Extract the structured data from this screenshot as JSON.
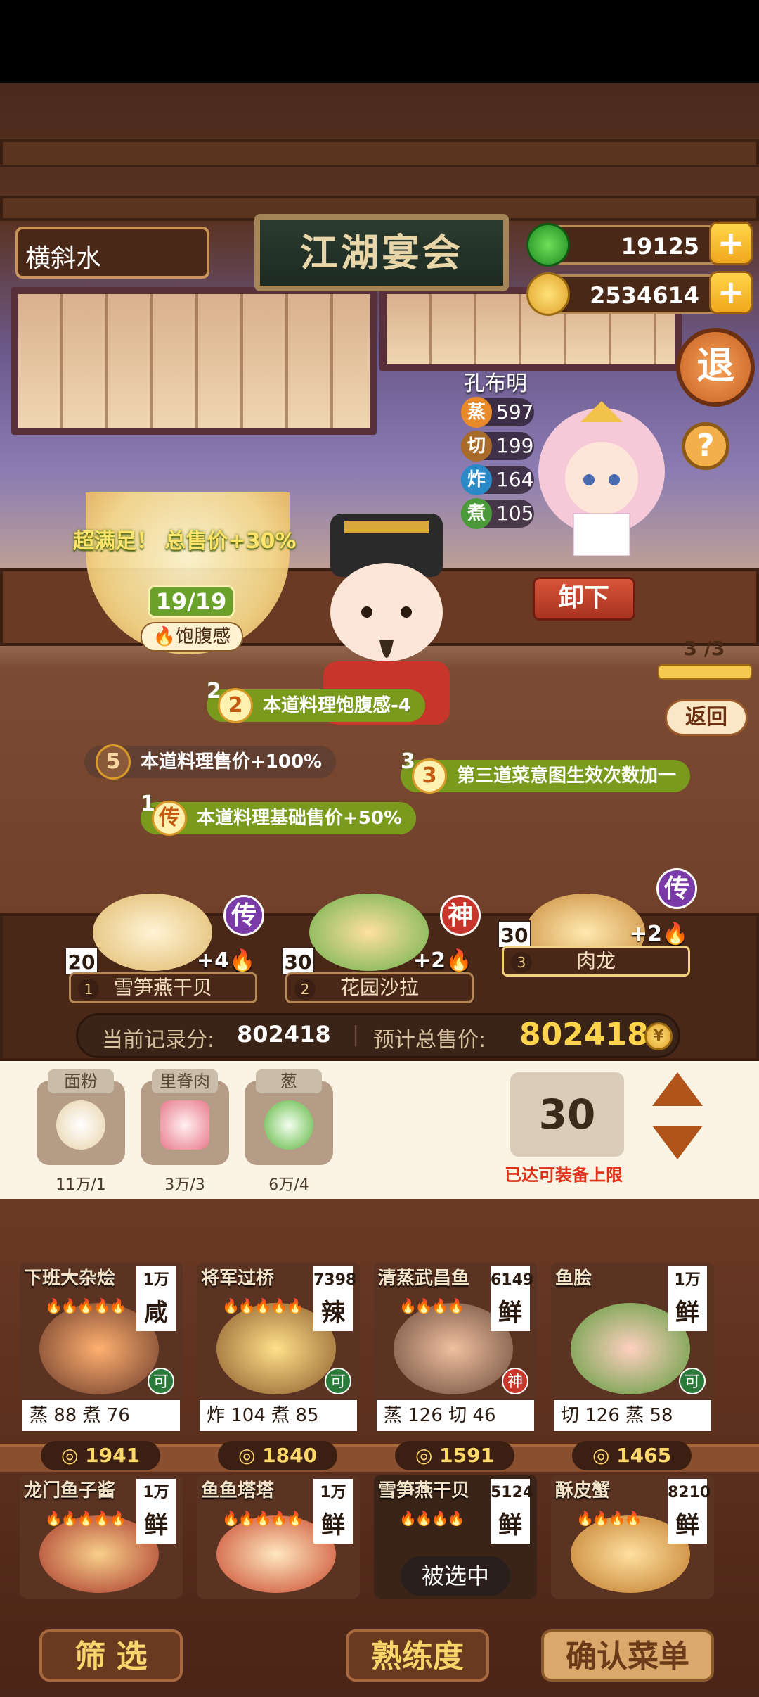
{
  "header": {
    "account_name": "横斜水",
    "title": "江湖宴会",
    "jade": "19125",
    "coins": "2534614",
    "exit_label": "退",
    "help_label": "?"
  },
  "chef": {
    "name": "孔布明",
    "stats": [
      {
        "key": "蒸",
        "value": "597",
        "color": "#e8892a"
      },
      {
        "key": "切",
        "value": "199",
        "color": "#a86b2a"
      },
      {
        "key": "炸",
        "value": "164",
        "color": "#2a8ac8"
      },
      {
        "key": "煮",
        "value": "105",
        "color": "#4a9a3a"
      }
    ],
    "unload_label": "卸下"
  },
  "satiety": {
    "bonus_text": "超满足！ 总售价+30%",
    "count": "19/19",
    "label": "饱腹感"
  },
  "progress": {
    "text": "3 /3",
    "return_label": "返回"
  },
  "effects": [
    {
      "num": "2",
      "icon": "2",
      "text": "本道料理饱腹感-4"
    },
    {
      "num": "",
      "icon": "5",
      "text": "本道料理售价+100%"
    },
    {
      "num": "3",
      "icon": "3",
      "text": "第三道菜意图生效次数加一"
    },
    {
      "num": "1",
      "icon": "传",
      "text": "本道料理基础售价+50%"
    }
  ],
  "menu_slots": [
    {
      "index": "1",
      "qty": "20",
      "bonus": "+4",
      "name": "雪笋燕干贝",
      "tier": "传"
    },
    {
      "index": "2",
      "qty": "30",
      "bonus": "+2",
      "name": "花园沙拉",
      "tier": "神"
    },
    {
      "index": "3",
      "qty": "30",
      "bonus": "+2",
      "name": "肉龙",
      "tier": "传"
    }
  ],
  "scores": {
    "record_label": "当前记录分:",
    "record_value": "802418",
    "total_label": "预计总售价:",
    "total_value": "802418"
  },
  "ingredients": [
    {
      "name": "面粉",
      "count": "11万/1"
    },
    {
      "name": "里脊肉",
      "count": "3万/3"
    },
    {
      "name": "葱",
      "count": "6万/4"
    }
  ],
  "equip": {
    "value": "30",
    "note": "已达可装备上限"
  },
  "recipes": [
    {
      "name": "下班大杂烩",
      "price_tag": "1万",
      "taste": "咸",
      "flames": "🔥🔥🔥🔥🔥",
      "mark": "可",
      "skills": "蒸 88  煮 76",
      "cost": "1941"
    },
    {
      "name": "将军过桥",
      "price_tag": "7398",
      "taste": "辣",
      "flames": "🔥🔥🔥🔥🔥",
      "mark": "可",
      "skills": "炸 104  煮 85",
      "cost": "1840"
    },
    {
      "name": "清蒸武昌鱼",
      "price_tag": "6149",
      "taste": "鲜",
      "flames": "🔥🔥🔥🔥",
      "mark": "神",
      "skills": "蒸 126  切 46",
      "cost": "1591"
    },
    {
      "name": "鱼脍",
      "price_tag": "1万",
      "taste": "鲜",
      "flames": "",
      "mark": "可",
      "skills": "切 126  蒸 58",
      "cost": "1465"
    },
    {
      "name": "龙门鱼子酱",
      "price_tag": "1万",
      "taste": "鲜",
      "flames": "🔥🔥🔥🔥🔥",
      "mark": "",
      "skills": "",
      "cost": "",
      "selected": ""
    },
    {
      "name": "鱼鱼塔塔",
      "price_tag": "1万",
      "taste": "鲜",
      "flames": "🔥🔥🔥🔥🔥",
      "mark": "",
      "skills": "",
      "cost": "",
      "selected": ""
    },
    {
      "name": "雪笋燕干贝",
      "price_tag": "5124",
      "taste": "鲜",
      "flames": "🔥🔥🔥🔥",
      "mark": "",
      "skills": "",
      "cost": "",
      "selected": "被选中"
    },
    {
      "name": "酥皮蟹",
      "price_tag": "8210",
      "taste": "鲜",
      "flames": "🔥🔥🔥🔥",
      "mark": "",
      "skills": "",
      "cost": "",
      "selected": ""
    }
  ],
  "buttons": {
    "filter": "筛  选",
    "proficiency": "熟练度",
    "confirm": "确认菜单"
  }
}
